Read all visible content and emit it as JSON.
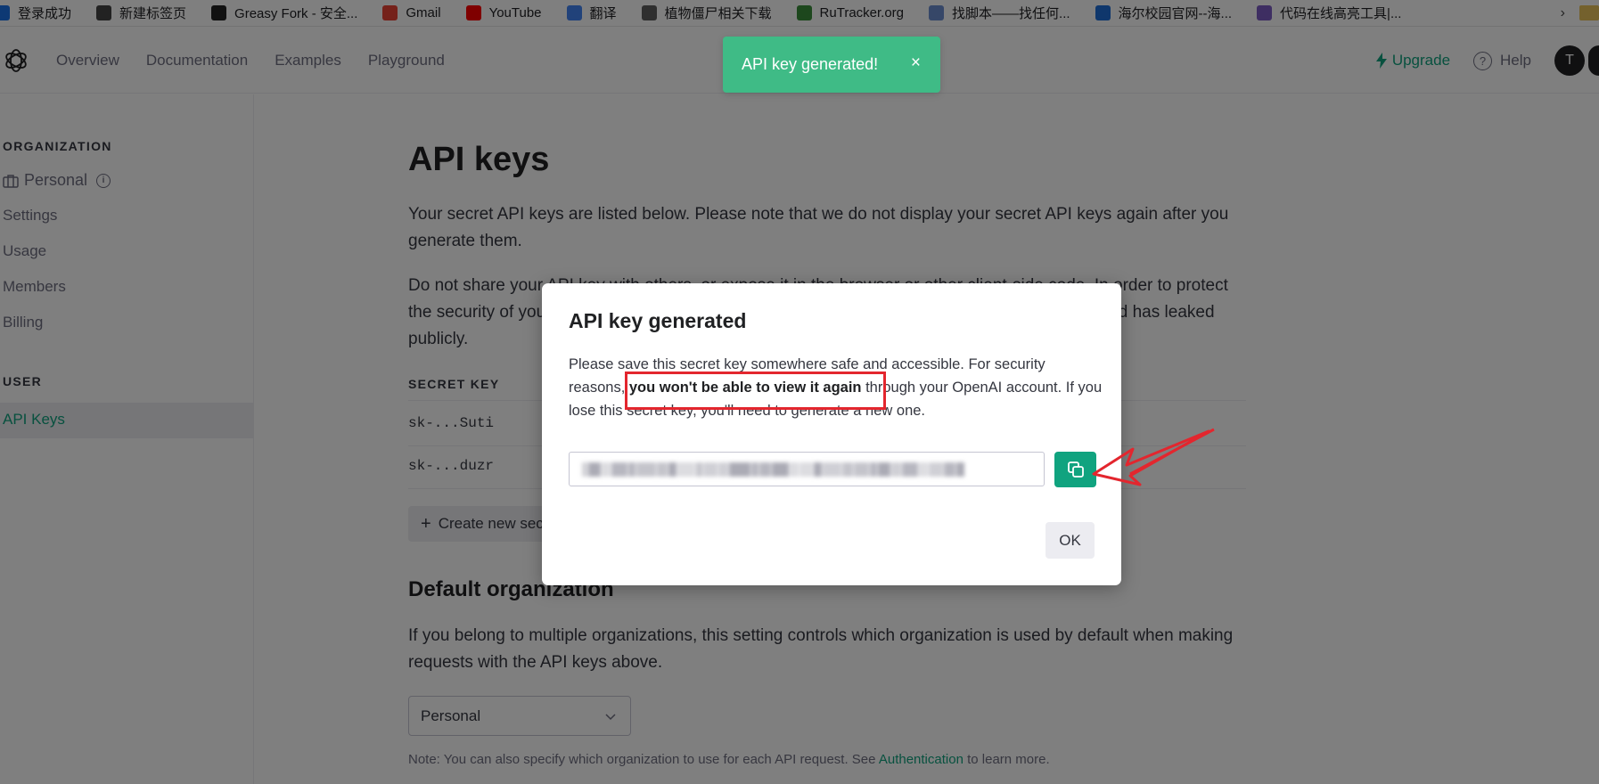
{
  "bookmarks": [
    {
      "label": "登录成功",
      "icon": "globe-icon",
      "color": "#1a73e8"
    },
    {
      "label": "新建标签页",
      "icon": "new-tab-icon",
      "color": "#444444"
    },
    {
      "label": "Greasy Fork - 安全...",
      "icon": "greasyfork-icon",
      "color": "#222222"
    },
    {
      "label": "Gmail",
      "icon": "gmail-icon",
      "color": "#ea4335"
    },
    {
      "label": "YouTube",
      "icon": "youtube-icon",
      "color": "#ff0000"
    },
    {
      "label": "翻译",
      "icon": "translate-icon",
      "color": "#4285f4"
    },
    {
      "label": "植物僵尸相关下载",
      "icon": "site-icon",
      "color": "#5f5f5f"
    },
    {
      "label": "RuTracker.org",
      "icon": "rutracker-icon",
      "color": "#3b8f3b"
    },
    {
      "label": "找脚本——找任何...",
      "icon": "script-icon",
      "color": "#6d8fd1"
    },
    {
      "label": "海尔校园官网--海...",
      "icon": "haier-icon",
      "color": "#1e6fd9"
    },
    {
      "label": "代码在线高亮工具|...",
      "icon": "code-icon",
      "color": "#7d5cc4"
    }
  ],
  "header": {
    "nav": [
      "Overview",
      "Documentation",
      "Examples",
      "Playground"
    ],
    "upgrade": "Upgrade",
    "help": "Help",
    "avatar": "T"
  },
  "toast": {
    "text": "API key generated!",
    "close": "×"
  },
  "sidebar": {
    "org_heading": "ORGANIZATION",
    "personal": "Personal",
    "settings": "Settings",
    "usage": "Usage",
    "members": "Members",
    "billing": "Billing",
    "user_heading": "USER",
    "api_keys": "API Keys"
  },
  "main": {
    "title": "API keys",
    "intro": "Your secret API keys are listed below. Please note that we do not display your secret API keys again after you generate them.",
    "warning": "Do not share your API key with others, or expose it in the browser or other client-side code. In order to protect the security of your account, OpenAI may also automatically rotate any API key that we've found has leaked publicly.",
    "secret_key_header": "SECRET KEY",
    "keys": [
      "sk-...Suti",
      "sk-...duzr"
    ],
    "create_button": "Create new secret key",
    "default_org_heading": "Default organization",
    "default_org_text": "If you belong to multiple organizations, this setting controls which organization is used by default when making requests with the API keys above.",
    "org_select_value": "Personal",
    "note_prefix": "Note: You can also specify which organization to use for each API request. See ",
    "note_link": "Authentication",
    "note_suffix": " to learn more."
  },
  "modal": {
    "title": "API key generated",
    "body_prefix": "Please save this secret key somewhere safe and accessible. For security reasons, ",
    "body_bold": "you won't be able to view it again",
    "body_suffix": " through your OpenAI account. If you lose this secret key, you'll need to generate a new one.",
    "ok": "OK"
  },
  "colors": {
    "accent": "#10a37f",
    "toast": "#3fbb86",
    "annotation": "#e3262e"
  }
}
